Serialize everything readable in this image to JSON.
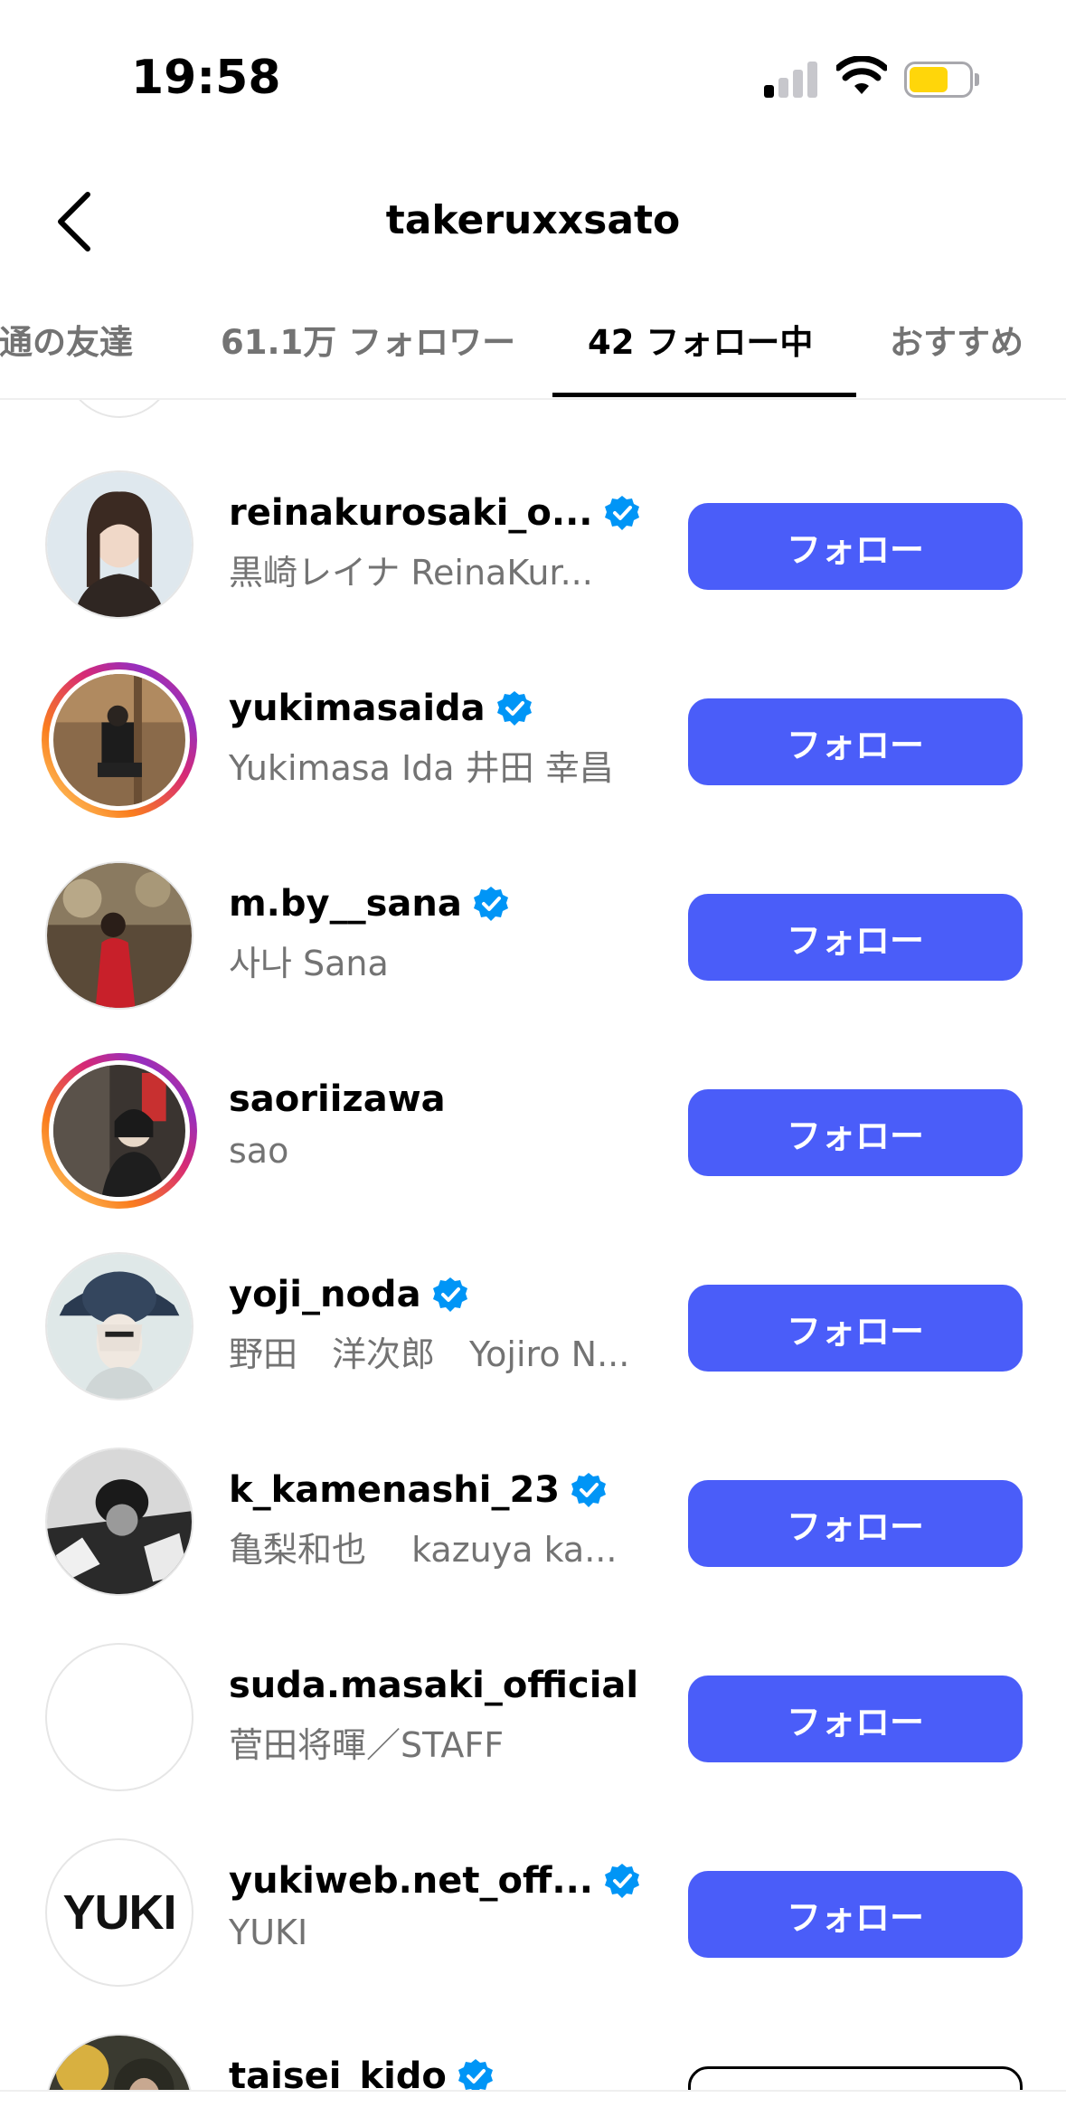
{
  "status_bar": {
    "time": "19:58",
    "battery_color": "#ffd60a"
  },
  "header": {
    "title": "takeruxxsato",
    "back_icon": "chevron-left-icon"
  },
  "tabs": [
    {
      "label": "共通の友達",
      "active": false
    },
    {
      "label": "61.1万 フォロワー",
      "active": false
    },
    {
      "label": "42 フォロー中",
      "active": true
    },
    {
      "label": "おすすめ",
      "active": false
    }
  ],
  "accent_color": "#4a5df9",
  "verified_color": "#0095f6",
  "accounts": [
    {
      "username": "reinakurosaki_o...",
      "fullname": "黒崎レイナ ReinaKur...",
      "verified": true,
      "story_ring": false,
      "button": "フォロー"
    },
    {
      "username": "yukimasaida",
      "fullname": "Yukimasa Ida 井田 幸昌",
      "verified": true,
      "story_ring": true,
      "button": "フォロー"
    },
    {
      "username": "m.by__sana",
      "fullname": "사나 Sana",
      "verified": true,
      "story_ring": false,
      "button": "フォロー"
    },
    {
      "username": "saoriizawa",
      "fullname": "sao",
      "verified": false,
      "story_ring": true,
      "button": "フォロー"
    },
    {
      "username": "yoji_noda",
      "fullname": "野田　洋次郎　Yojiro N...",
      "verified": true,
      "story_ring": false,
      "button": "フォロー"
    },
    {
      "username": "k_kamenashi_23",
      "fullname": "亀梨和也　 kazuya ka...",
      "verified": true,
      "story_ring": false,
      "button": "フォロー"
    },
    {
      "username": "suda.masaki_official",
      "fullname": "菅田将暉／STAFF",
      "verified": false,
      "story_ring": false,
      "button": "フォロー"
    },
    {
      "username": "yukiweb.net_off...",
      "fullname": "YUKI",
      "verified": true,
      "story_ring": false,
      "button": "フォロー",
      "avatar_text": "YUKI"
    },
    {
      "username": "taisei_kido",
      "fullname": "",
      "verified": true,
      "story_ring": false,
      "button": ""
    }
  ]
}
